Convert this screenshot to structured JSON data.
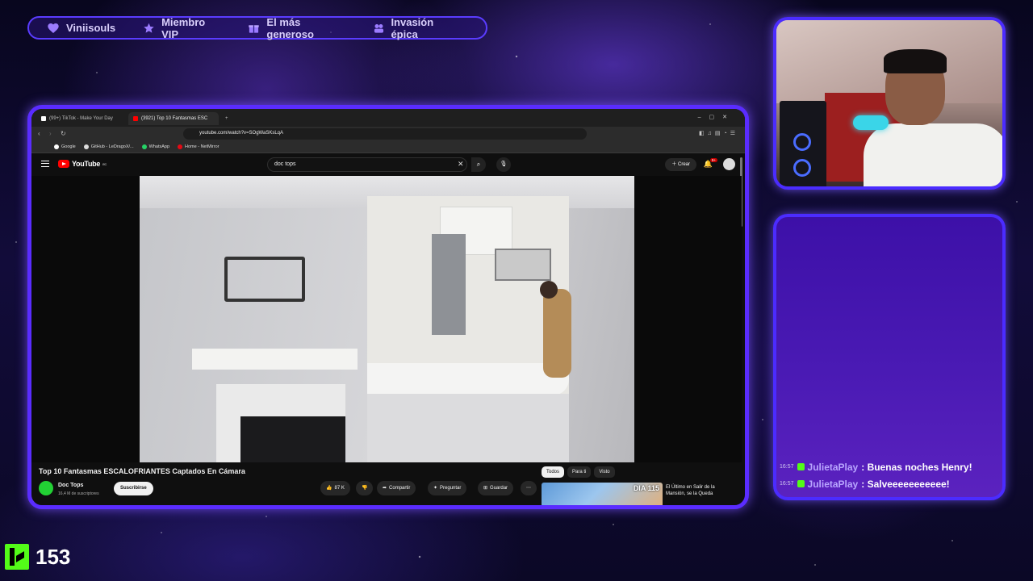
{
  "alerts": {
    "items": [
      {
        "label": "Viniisouls",
        "icon": "heart-icon"
      },
      {
        "label": "Miembro VIP",
        "icon": "star-icon"
      },
      {
        "label": "El más generoso",
        "icon": "gift-icon"
      },
      {
        "label": "Invasión épica",
        "icon": "raid-icon"
      }
    ]
  },
  "browser": {
    "tabs": [
      {
        "title": "(99+) TikTok - Make Your Day"
      },
      {
        "title": "(3921) Top 10 Fantasmas ESC"
      }
    ],
    "url": "youtube.com/watch?v=SOgWaSKsLqA",
    "bookmarks": [
      "Google",
      "GitHub - LeDragoX/...",
      "WhatsApp",
      "Home - NetMirror"
    ]
  },
  "youtube": {
    "logo_text": "YouTube",
    "logo_sup": "EC",
    "search_value": "doc tops",
    "create_label": "Crear",
    "notif_badge": "9+",
    "video_title": "Top 10 Fantasmas ESCALOFRIANTES Captados En Cámara",
    "channel_name": "Doc Tops",
    "channel_subs": "16,4 M de suscriptores",
    "subscribe_label": "Suscribirse",
    "like_count": "87 K",
    "share_label": "Compartir",
    "ask_label": "Preguntar",
    "save_label": "Guardar",
    "chips": [
      "Todos",
      "Para ti",
      "Visto"
    ],
    "rec_thumb_text": "DIA 115",
    "rec_title": "El Último en Salir de la Mansión, se la Queda"
  },
  "chat": {
    "messages": [
      {
        "time": "16:57",
        "user": "JulietaPlay",
        "text": ": Buenas noches Henry!"
      },
      {
        "time": "16:57",
        "user": "JulietaPlay",
        "text": ": Salveeeeeeeeeee!"
      }
    ]
  },
  "kick": {
    "viewer_count": "153"
  },
  "colors": {
    "accent": "#5a2cff",
    "kick_green": "#53fc18",
    "chat_user": "#b9a6ff"
  }
}
